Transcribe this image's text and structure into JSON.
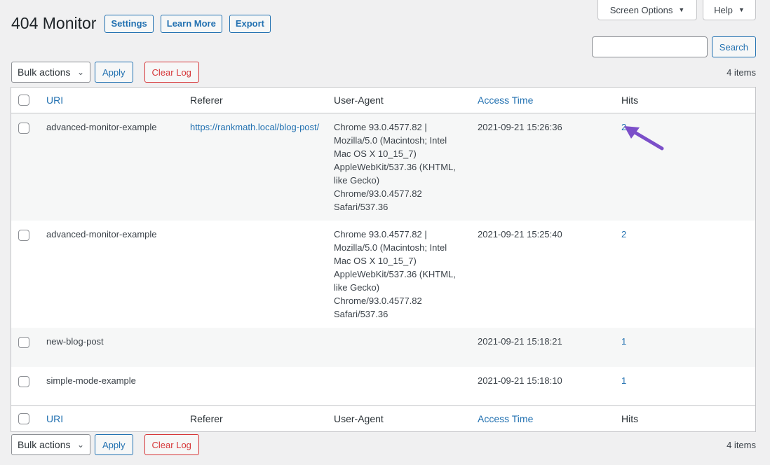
{
  "screen_meta": {
    "screen_options_label": "Screen Options",
    "help_label": "Help"
  },
  "header": {
    "title": "404 Monitor",
    "actions": [
      "Settings",
      "Learn More",
      "Export"
    ]
  },
  "search": {
    "placeholder": "",
    "button_label": "Search"
  },
  "tablenav": {
    "bulk_label": "Bulk actions",
    "apply_label": "Apply",
    "clear_label": "Clear Log",
    "count": "4 items"
  },
  "columns": {
    "uri": "URI",
    "referer": "Referer",
    "user_agent": "User-Agent",
    "access_time": "Access Time",
    "hits": "Hits"
  },
  "rows": [
    {
      "uri": "advanced-monitor-example",
      "referer": "https://rankmath.local/blog-post/",
      "user_agent": "Chrome 93.0.4577.82 | Mozilla/5.0 (Macintosh; Intel Mac OS X 10_15_7) AppleWebKit/537.36 (KHTML, like Gecko) Chrome/93.0.4577.82 Safari/537.36",
      "access_time": "2021-09-21 15:26:36",
      "hits": "2"
    },
    {
      "uri": "advanced-monitor-example",
      "referer": "",
      "user_agent": "Chrome 93.0.4577.82 | Mozilla/5.0 (Macintosh; Intel Mac OS X 10_15_7) AppleWebKit/537.36 (KHTML, like Gecko) Chrome/93.0.4577.82 Safari/537.36",
      "access_time": "2021-09-21 15:25:40",
      "hits": "2"
    },
    {
      "uri": "new-blog-post",
      "referer": "",
      "user_agent": "",
      "access_time": "2021-09-21 15:18:21",
      "hits": "1"
    },
    {
      "uri": "simple-mode-example",
      "referer": "",
      "user_agent": "",
      "access_time": "2021-09-21 15:18:10",
      "hits": "1"
    }
  ],
  "colors": {
    "accent": "#2271b1",
    "danger": "#d63638",
    "annotation_arrow": "#7b4fc9"
  }
}
